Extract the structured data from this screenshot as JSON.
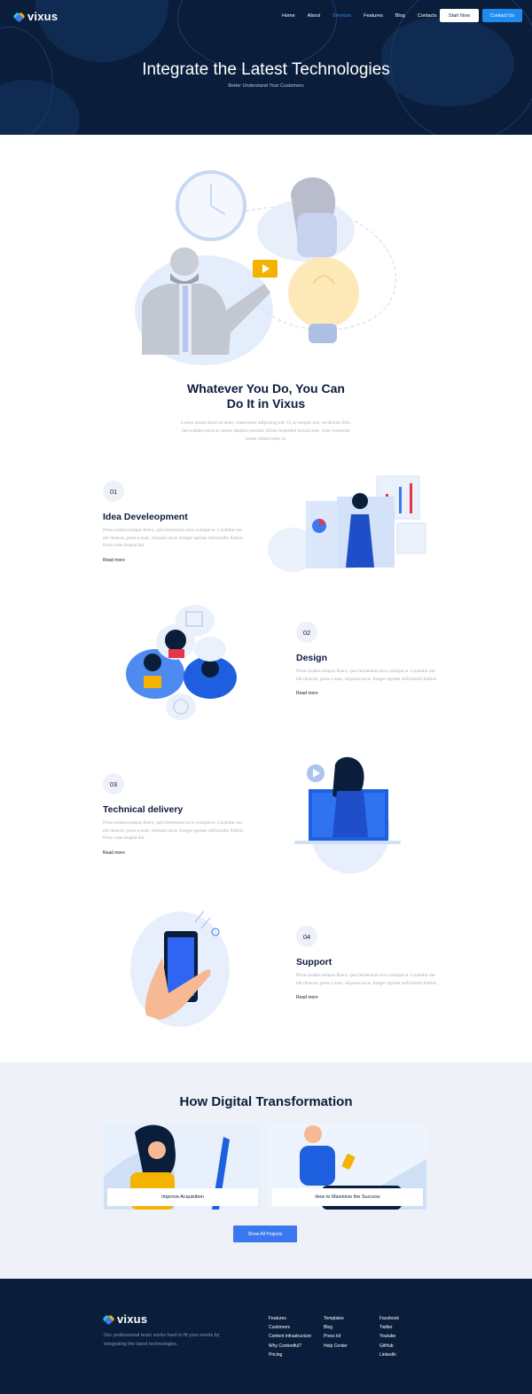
{
  "brand": {
    "name": "vixus"
  },
  "nav": {
    "items": [
      {
        "label": "Home",
        "active": false
      },
      {
        "label": "About",
        "active": false
      },
      {
        "label": "Services",
        "active": true
      },
      {
        "label": "Features",
        "active": false
      },
      {
        "label": "Blog",
        "active": false
      },
      {
        "label": "Contacts",
        "active": false
      }
    ],
    "start_label": "Start Now",
    "contact_label": "Contact Us"
  },
  "hero": {
    "title": "Integrate the Latest Technologies",
    "subtitle": "Better Understand Your Customers"
  },
  "intro": {
    "title_line1": "Whatever You Do, You Can",
    "title_line2": "Do It in Vixus",
    "text": "Lorem ipsum dolor sit amet, consectetur adipiscing elit. Ut ac tempor non, eu dictum felis. Sed sodales porta ac neque dapibus pretium. Etiam imperdiet lacinia sem, vitae commodo neque ullamcorper ut."
  },
  "features": [
    {
      "number": "01",
      "title": "Idea Develeopment",
      "text": "Proin sodales tempus libero, quis fermentum arcu volutpat et. Curabitur nec elit rhoncus, porta a nunc, aliquam lacus. Integer egestas sollicitudin finibus. Proin vitae feugiat dui.",
      "link": "Read more"
    },
    {
      "number": "02",
      "title": "Design",
      "text": "Proin sodales tempus libero, quis fermentum arcu volutpat et. Curabitur nec elit rhoncus, porta a nunc, aliquam lacus. Integer egestas sollicitudin finibus.",
      "link": "Read more"
    },
    {
      "number": "03",
      "title": "Technical delivery",
      "text": "Proin sodales tempus libero, quis fermentum arcu volutpat et. Curabitur nec elit rhoncus, porta a nunc, aliquam lacus. Integer egestas sollicitudin finibus. Proin vitae feugiat dui.",
      "link": "Read more"
    },
    {
      "number": "04",
      "title": "Support",
      "text": "Proin sodales tempus libero, quis fermentum arcu volutpat et. Curabitur nec elit rhoncus, porta a nunc, aliquam lacus. Integer egestas sollicitudin finibus.",
      "link": "Read more"
    }
  ],
  "digital": {
    "title": "How Digital Transformation",
    "cards": [
      {
        "label": "Improve Acquisition"
      },
      {
        "label": "How to Maximize the Success"
      }
    ],
    "button_label": "Show All Projects"
  },
  "footer": {
    "about": "Our professional team works hard to fit your needs by integrating the latest technologies.",
    "col1": [
      "Features",
      "Customers",
      "Content infrastructure",
      "Why Contentful?",
      "Pricing"
    ],
    "col2": [
      "Templates",
      "Blog",
      "Press kit",
      "Help Center"
    ],
    "col3": [
      "Facebook",
      "Twitter",
      "Youtube",
      "GitHub",
      "LinkedIn"
    ]
  },
  "colors": {
    "dark_navy": "#0a1e3c",
    "accent_blue": "#1f8bf0",
    "button_blue": "#3b78f0",
    "light_section": "#eef2f8",
    "illustration_yellow": "#f5b301"
  }
}
